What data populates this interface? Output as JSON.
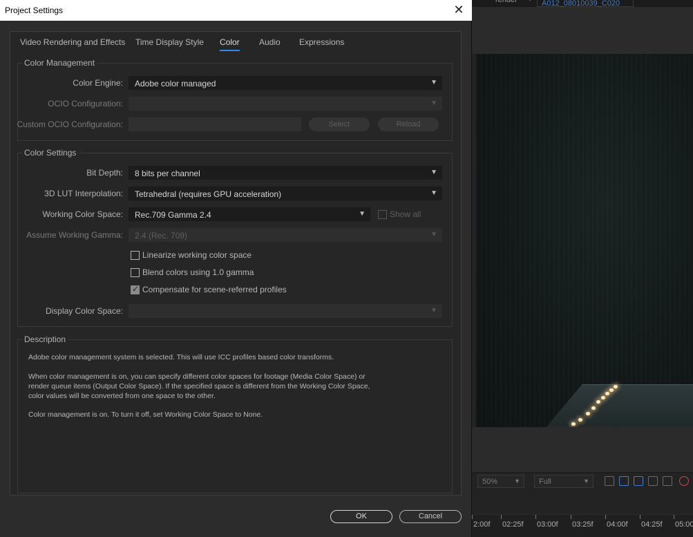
{
  "dialog": {
    "title": "Project Settings",
    "close_glyph": "✕",
    "tabs": [
      {
        "label": "Video Rendering and Effects",
        "active": false
      },
      {
        "label": "Time Display Style",
        "active": false
      },
      {
        "label": "Color",
        "active": true
      },
      {
        "label": "Audio",
        "active": false
      },
      {
        "label": "Expressions",
        "active": false
      }
    ],
    "color_management": {
      "title": "Color Management",
      "color_engine_label": "Color Engine:",
      "color_engine_value": "Adobe color managed",
      "ocio_config_label": "OCIO Configuration:",
      "ocio_config_value": "",
      "custom_ocio_label": "Custom OCIO Configuration:",
      "select_label": "Select",
      "reload_label": "Reload"
    },
    "color_settings": {
      "title": "Color Settings",
      "bit_depth_label": "Bit Depth:",
      "bit_depth_value": "8 bits per channel",
      "lut_label": "3D LUT Interpolation:",
      "lut_value": "Tetrahedral (requires GPU acceleration)",
      "working_space_label": "Working Color Space:",
      "working_space_value": "Rec.709 Gamma 2.4",
      "show_all_label": "Show all",
      "show_all_checked": false,
      "assume_gamma_label": "Assume Working Gamma:",
      "assume_gamma_value": "2.4 (Rec. 709)",
      "linearize_label": "Linearize working color space",
      "linearize_checked": false,
      "blend_label": "Blend colors using 1.0 gamma",
      "blend_checked": false,
      "compensate_label": "Compensate for scene-referred profiles",
      "compensate_checked": true,
      "display_space_label": "Display Color Space:",
      "display_space_value": ""
    },
    "description": {
      "title": "Description",
      "line1": "Adobe color management system is selected. This will use ICC profiles based color transforms.",
      "line2": "When color management is on, you can specify different color spaces for footage (Media Color Space) or",
      "line3": "render queue items (Output Color Space). If the specified space is different from the Working Color Space,",
      "line4": "color values will be converted from one space to the other.",
      "line5": "Color management is on. To turn it off, set Working Color Space to None."
    },
    "ok_label": "OK",
    "cancel_label": "Cancel"
  },
  "background_app": {
    "render_tab": "render",
    "comp_tab": "A012_08010039_C020",
    "zoom_value": "50%",
    "resolution_value": "Full",
    "timeline_ticks": [
      "2:00f",
      "02:25f",
      "03:00f",
      "03:25f",
      "04:00f",
      "04:25f",
      "05:00"
    ]
  },
  "colors": {
    "accent": "#2d8ceb",
    "dialog_bg": "#2c2c2c",
    "panel_bg": "#262626",
    "comp_tab_text": "#3c7fd4"
  }
}
